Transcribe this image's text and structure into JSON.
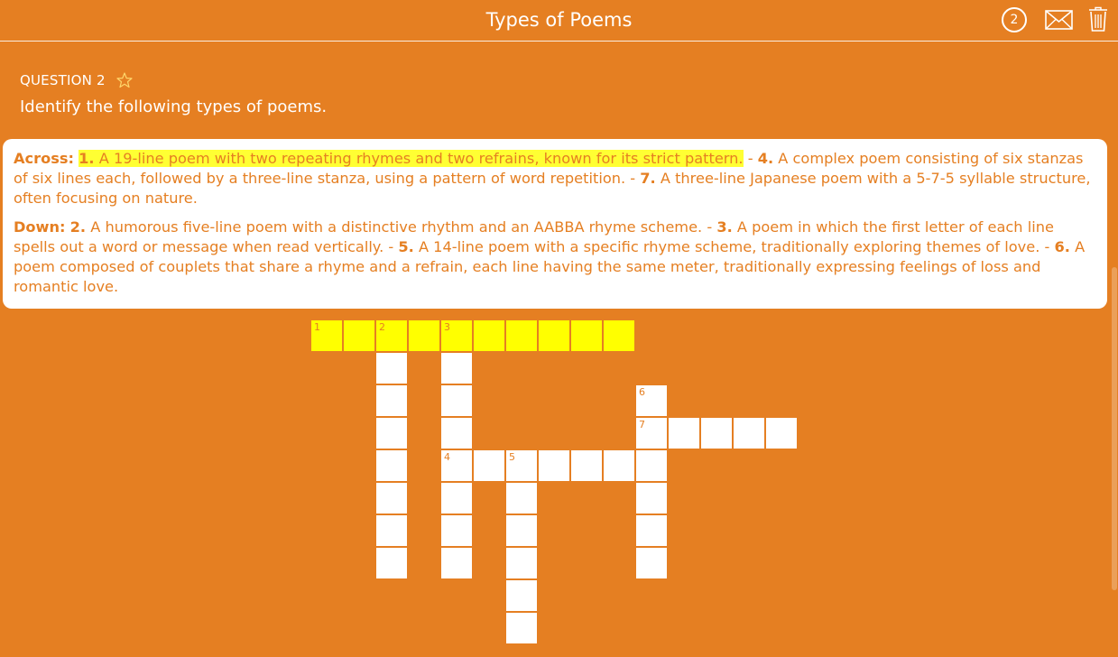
{
  "header": {
    "title": "Types of Poems",
    "timer": "2"
  },
  "question": {
    "label": "QUESTION 2",
    "text": "Identify the following types of poems."
  },
  "clues": {
    "across_label": "Across:",
    "down_label": "Down:",
    "separator": " - ",
    "across": [
      {
        "num": "1.",
        "text": "A 19-line poem with two repeating rhymes and two refrains, known for its strict pattern."
      },
      {
        "num": "4.",
        "text": "A complex poem consisting of six stanzas of six lines each, followed by a three-line stanza, using a pattern of word repetition."
      },
      {
        "num": "7.",
        "text": "A three-line Japanese poem with a 5-7-5 syllable structure, often focusing on nature."
      }
    ],
    "down": [
      {
        "num": "2.",
        "text": "A humorous five-line poem with a distinctive rhythm and an AABBA rhyme scheme."
      },
      {
        "num": "3.",
        "text": "A poem in which the first letter of each line spells out a word or message when read vertically."
      },
      {
        "num": "5.",
        "text": "A 14-line poem with a specific rhyme scheme, traditionally exploring themes of love."
      },
      {
        "num": "6.",
        "text": "A poem composed of couplets that share a rhyme and a refrain, each line having the same meter, traditionally expressing feelings of loss and romantic love."
      }
    ]
  },
  "grid": {
    "cells": [
      [
        0,
        0,
        "1",
        true
      ],
      [
        1,
        0,
        "",
        true
      ],
      [
        2,
        0,
        "2",
        true
      ],
      [
        3,
        0,
        "",
        true
      ],
      [
        4,
        0,
        "3",
        true
      ],
      [
        5,
        0,
        "",
        true
      ],
      [
        6,
        0,
        "",
        true
      ],
      [
        7,
        0,
        "",
        true
      ],
      [
        8,
        0,
        "",
        true
      ],
      [
        9,
        0,
        "",
        true
      ],
      [
        2,
        1,
        "",
        false
      ],
      [
        2,
        2,
        "",
        false
      ],
      [
        2,
        3,
        "",
        false
      ],
      [
        2,
        4,
        "",
        false
      ],
      [
        2,
        5,
        "",
        false
      ],
      [
        2,
        6,
        "",
        false
      ],
      [
        2,
        7,
        "",
        false
      ],
      [
        4,
        1,
        "",
        false
      ],
      [
        4,
        2,
        "",
        false
      ],
      [
        4,
        3,
        "",
        false
      ],
      [
        4,
        4,
        "4",
        false
      ],
      [
        4,
        5,
        "",
        false
      ],
      [
        4,
        6,
        "",
        false
      ],
      [
        4,
        7,
        "",
        false
      ],
      [
        5,
        4,
        "",
        false
      ],
      [
        6,
        4,
        "5",
        false
      ],
      [
        7,
        4,
        "",
        false
      ],
      [
        8,
        4,
        "",
        false
      ],
      [
        9,
        4,
        "",
        false
      ],
      [
        6,
        5,
        "",
        false
      ],
      [
        6,
        6,
        "",
        false
      ],
      [
        6,
        7,
        "",
        false
      ],
      [
        6,
        8,
        "",
        false
      ],
      [
        6,
        9,
        "",
        false
      ],
      [
        10,
        2,
        "6",
        false
      ],
      [
        10,
        3,
        "7",
        false
      ],
      [
        10,
        4,
        "",
        false
      ],
      [
        10,
        5,
        "",
        false
      ],
      [
        10,
        6,
        "",
        false
      ],
      [
        10,
        7,
        "",
        false
      ],
      [
        11,
        3,
        "",
        false
      ],
      [
        12,
        3,
        "",
        false
      ],
      [
        13,
        3,
        "",
        false
      ],
      [
        14,
        3,
        "",
        false
      ]
    ]
  },
  "colors": {
    "background": "#E57F22",
    "highlight": "#FFFF33",
    "active_cell": "#FFFF00",
    "cell": "#FFFFFF"
  },
  "icons": {
    "mail": "mail-icon",
    "trash": "trash-icon",
    "star": "star-icon"
  }
}
